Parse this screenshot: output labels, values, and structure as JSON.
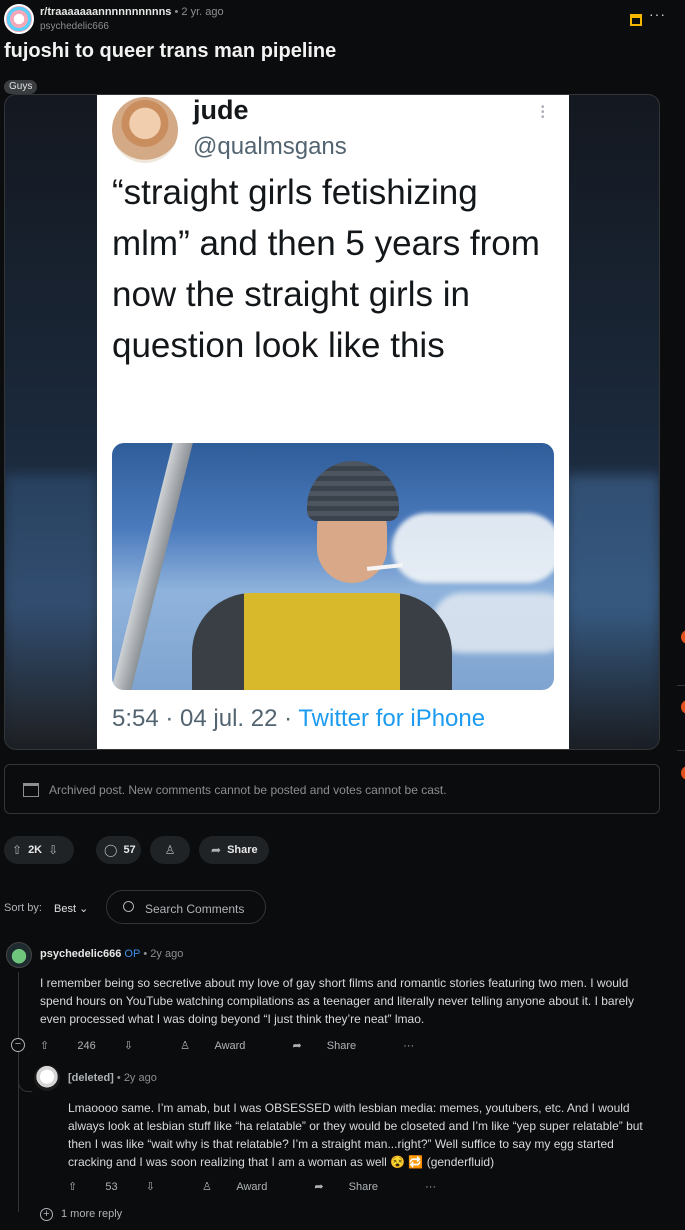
{
  "post": {
    "subreddit": "r/traaaaaaannnnnnnnnns",
    "separator": "•",
    "age": "2 yr. ago",
    "author": "psychedelic666",
    "title": "fujoshi to queer trans man pipeline",
    "flair": "Guys"
  },
  "tweet": {
    "name": "jude",
    "handle": "@qualmsgans",
    "text": "“straight girls fetishizing mlm” and then 5 years from now the straight girls in question look like this",
    "time": "5:54 · 04 jul. 22 · ",
    "source": "Twitter for iPhone"
  },
  "archived_notice": "Archived post. New comments cannot be posted and votes cannot be cast.",
  "actions": {
    "score": "2K",
    "comments": "57",
    "share": "Share"
  },
  "sort": {
    "label": "Sort by:",
    "value": "Best",
    "search_placeholder": "Search Comments"
  },
  "comments": [
    {
      "user": "psychedelic666",
      "op": "OP",
      "meta": "• 2y ago",
      "body": "I remember being so secretive about my love of gay short films and romantic stories featuring two men. I would spend hours on YouTube watching compilations as a teenager and literally never telling anyone about it. I barely even processed what I was doing beyond “I just think they’re neat” lmao.",
      "score": "246",
      "award": "Award",
      "share": "Share",
      "more": "···"
    },
    {
      "user": "[deleted]",
      "meta": "• 2y ago",
      "body": "Lmaoooo same. I’m amab, but I was OBSESSED with lesbian media: memes, youtubers, etc. And I would always look at lesbian stuff like “ha relatable” or they would be closeted and I’m like “yep super relatable” but then I was like “wait why is that relatable? I’m a straight man...right?” Well suffice to say my egg started cracking and I was soon realizing that I am a woman as well 😵 🔁 (genderfluid)",
      "score": "53",
      "award": "Award",
      "share": "Share",
      "more": "···"
    }
  ],
  "more_replies": "1 more reply",
  "colors": {
    "background": "#0b0c0d",
    "accent_op": "#3b8fe7",
    "twitter_blue": "#1d9bf0"
  }
}
